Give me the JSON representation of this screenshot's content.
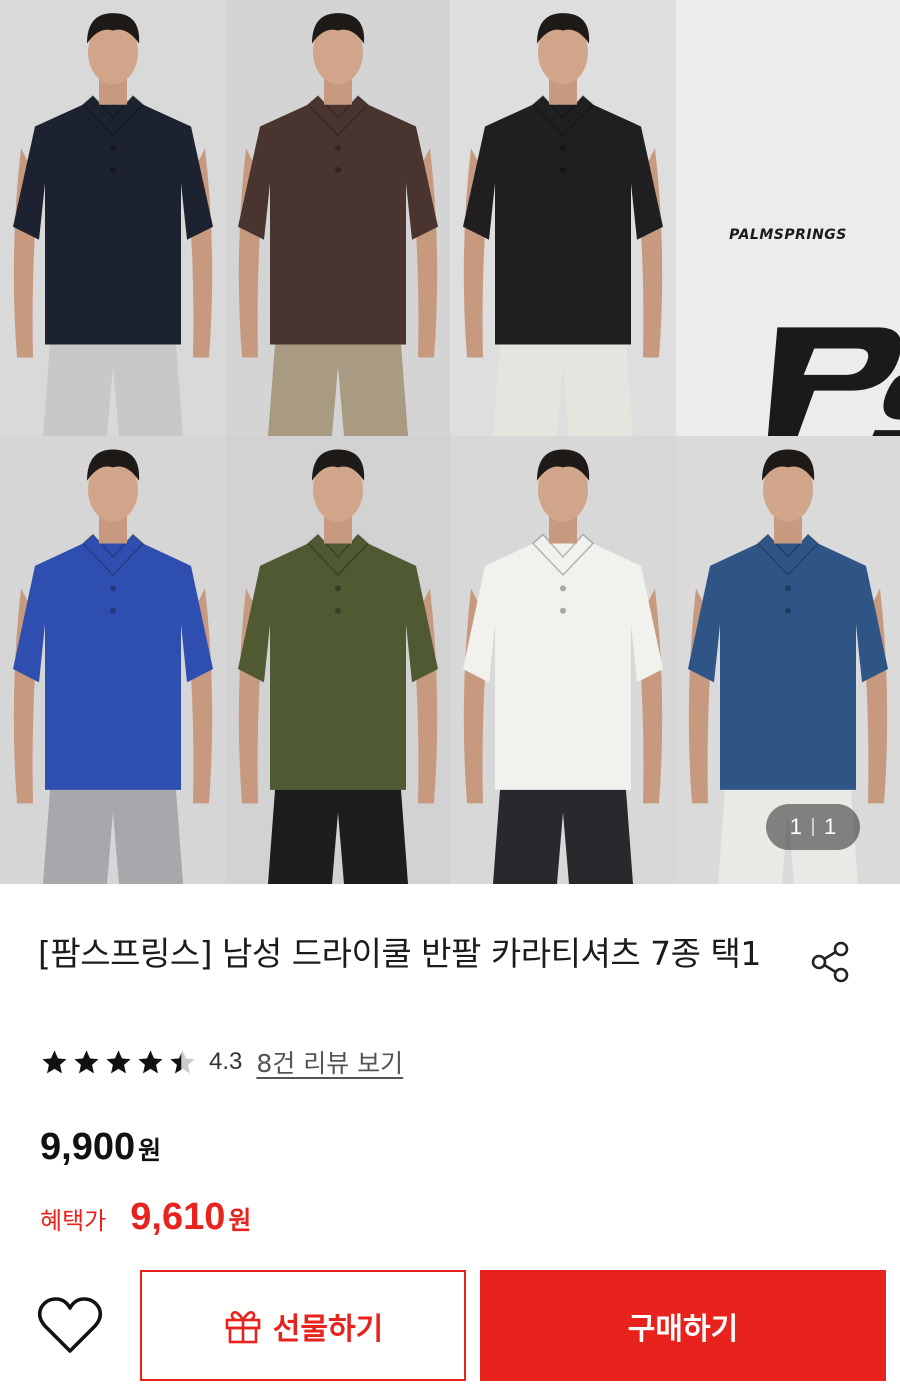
{
  "gallery": {
    "brand_logo_text": "PALMSPRINGS",
    "brand_logo_mark": "PS",
    "models": [
      {
        "shirt": "#1c2230",
        "pants": "#c8c8c8",
        "bg": "#d9d9d9"
      },
      {
        "shirt": "#4a3430",
        "pants": "#a99a82",
        "bg": "#d4d4d4"
      },
      {
        "shirt": "#1f1f22",
        "pants": "#e6e4de",
        "bg": "#dedede"
      },
      {
        "shirt": "#2f4fb0",
        "pants": "#a7a8ab",
        "bg": "#d6d6d6"
      },
      {
        "shirt": "#4f5a33",
        "pants": "#1d1d1f",
        "bg": "#d2d2d2"
      },
      {
        "shirt": "#f1f1ee",
        "pants": "#27292c",
        "bg": "#d8d8d8"
      },
      {
        "shirt": "#2e5585",
        "pants": "#e9e9e6",
        "bg": "#dadada"
      }
    ],
    "pager_current": "1",
    "pager_total": "1"
  },
  "product": {
    "title": "[팜스프링스] 남성 드라이쿨 반팔 카라티셔츠 7종 택1",
    "rating": 4.3,
    "rating_text": "4.3",
    "review_link": "8건 리뷰 보기",
    "price": "9,900",
    "price_unit": "원",
    "benefit_label": "혜택가",
    "benefit_price": "9,610",
    "benefit_unit": "원"
  },
  "actions": {
    "gift_label": "선물하기",
    "buy_label": "구매하기"
  },
  "icons": {
    "share": "share-icon",
    "heart": "heart-icon",
    "gift": "gift-icon",
    "star": "star-icon"
  },
  "colors": {
    "accent": "#e8231e",
    "star": "#111111",
    "star_empty": "#cccccc"
  }
}
